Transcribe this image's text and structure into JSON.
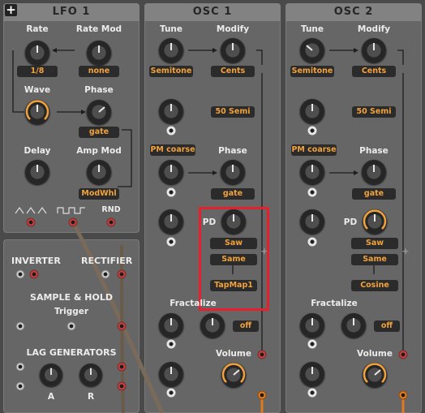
{
  "lfo": {
    "title": "LFO 1",
    "rate_label": "Rate",
    "rate_value": "1/8",
    "ratemod_label": "Rate Mod",
    "ratemod_value": "none",
    "wave_label": "Wave",
    "phase_label": "Phase",
    "phase_value": "gate",
    "delay_label": "Delay",
    "ampmod_label": "Amp Mod",
    "ampmod_value": "ModWhl",
    "rnd_label": "RND"
  },
  "utils": {
    "inverter": "INVERTER",
    "rectifier": "RECTIFIER",
    "sample_hold": "SAMPLE & HOLD",
    "trigger": "Trigger",
    "lag": "LAG GENERATORS",
    "a": "A",
    "r": "R"
  },
  "osc1": {
    "title": "OSC 1",
    "tune_label": "Tune",
    "tune_value": "Semitone",
    "modify_label": "Modify",
    "modify_value": "Cents",
    "semi_value": "50 Semi",
    "pm_value": "PM coarse",
    "phase_label": "Phase",
    "phase_value": "gate",
    "pd_label": "PD",
    "pd_wave": "Saw",
    "pd_mode": "Same",
    "pd_map": "TapMap1",
    "fractalize_label": "Fractalize",
    "fractalize_value": "off",
    "volume_label": "Volume"
  },
  "osc2": {
    "title": "OSC 2",
    "tune_label": "Tune",
    "tune_value": "Semitone",
    "modify_label": "Modify",
    "modify_value": "Cents",
    "semi_value": "50 Semi",
    "pm_value": "PM coarse",
    "phase_label": "Phase",
    "phase_value": "gate",
    "pd_label": "PD",
    "pd_wave": "Saw",
    "pd_mode": "Same",
    "pd_map": "Cosine",
    "fractalize_label": "Fractalize",
    "fractalize_value": "off",
    "volume_label": "Volume"
  },
  "colors": {
    "accent": "#f2a23c",
    "highlight": "#e8202e",
    "panel": "#666666"
  }
}
